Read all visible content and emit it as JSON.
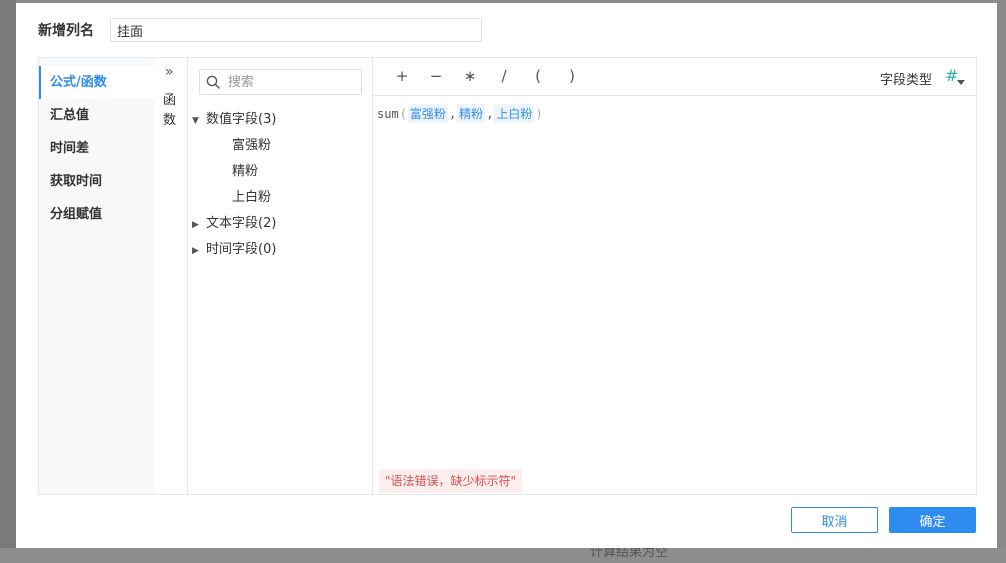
{
  "name_field": {
    "label": "新增列名",
    "value": "挂面"
  },
  "categories": [
    {
      "label": "公式/函数",
      "active": true
    },
    {
      "label": "汇总值"
    },
    {
      "label": "时间差"
    },
    {
      "label": "获取时间"
    },
    {
      "label": "分组赋值"
    }
  ],
  "function_toggle": {
    "arrows": "»",
    "label_line1": "函",
    "label_line2": "数"
  },
  "search": {
    "placeholder": "搜索"
  },
  "field_tree": {
    "groups": [
      {
        "label": "数值字段(3)",
        "expanded": true,
        "items": [
          "富强粉",
          "精粉",
          "上白粉"
        ]
      },
      {
        "label": "文本字段(2)",
        "expanded": false
      },
      {
        "label": "时间字段(0)",
        "expanded": false
      }
    ]
  },
  "operators": [
    "+",
    "−",
    "∗",
    "/",
    "(",
    ")"
  ],
  "field_type": {
    "label": "字段类型",
    "icon": "#",
    "icon_name": "number-type-icon",
    "color": "#2bb5a6"
  },
  "formula": {
    "function": "sum",
    "open_paren": "(",
    "close_paren": ")",
    "comma": ",",
    "tokens": [
      "富强粉",
      "精粉",
      "上白粉"
    ]
  },
  "error": {
    "message": "\"语法错误，缺少标示符\""
  },
  "buttons": {
    "cancel": "取消",
    "ok": "确定"
  },
  "background_text": "计算结果为空",
  "colors": {
    "accent": "#2f8cee",
    "error": "#e04b4b",
    "token_bg": "#eef4fb"
  }
}
